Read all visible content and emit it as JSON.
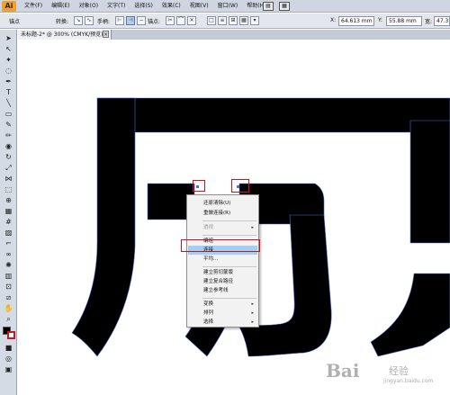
{
  "menubar": {
    "app_logo": "Ai",
    "items": [
      "文件(F)",
      "编辑(E)",
      "对象(O)",
      "文字(T)",
      "选择(S)",
      "效果(C)",
      "视图(V)",
      "窗口(W)",
      "帮助(H)"
    ]
  },
  "controlbar": {
    "anchor_label": "锚点",
    "convert_label": "转换:",
    "handle_label": "手柄:",
    "anchor_label2": "锚点:",
    "x_label": "X:",
    "x_value": "64.613 mm",
    "y_label": "Y:",
    "y_value": "55.88 mm",
    "w_label": "宽:",
    "w_value": "47.3"
  },
  "document": {
    "tab_title": "未标题-2* @ 300% (CMYK/预览)",
    "close_glyph": "×"
  },
  "context_menu": {
    "items": [
      {
        "label": "还原清除(U)",
        "disabled": false,
        "submenu": false
      },
      {
        "label": "重做连接(R)",
        "disabled": false,
        "submenu": false
      },
      {
        "label": "透视",
        "disabled": true,
        "submenu": true
      },
      {
        "label": "编组",
        "disabled": false,
        "submenu": false
      },
      {
        "label": "连接",
        "disabled": false,
        "submenu": false,
        "highlight": true
      },
      {
        "label": "平均...",
        "disabled": false,
        "submenu": false
      },
      {
        "label": "建立剪切蒙版",
        "disabled": false,
        "submenu": false
      },
      {
        "label": "建立复合路径",
        "disabled": false,
        "submenu": false
      },
      {
        "label": "建立参考线",
        "disabled": false,
        "submenu": false
      },
      {
        "label": "变换",
        "disabled": false,
        "submenu": true
      },
      {
        "label": "排列",
        "disabled": false,
        "submenu": true
      },
      {
        "label": "选择",
        "disabled": false,
        "submenu": true
      }
    ],
    "arrow_glyph": "▸"
  },
  "watermark": {
    "brand": "Bai",
    "sub": "经验",
    "url": "jingyan.baidu.com"
  },
  "colors": {
    "selection_red": "#d0121b",
    "menu_highlight": "#9fd0f6",
    "artwork_fill": "#000000",
    "path_outline": "#4a6fd8"
  }
}
